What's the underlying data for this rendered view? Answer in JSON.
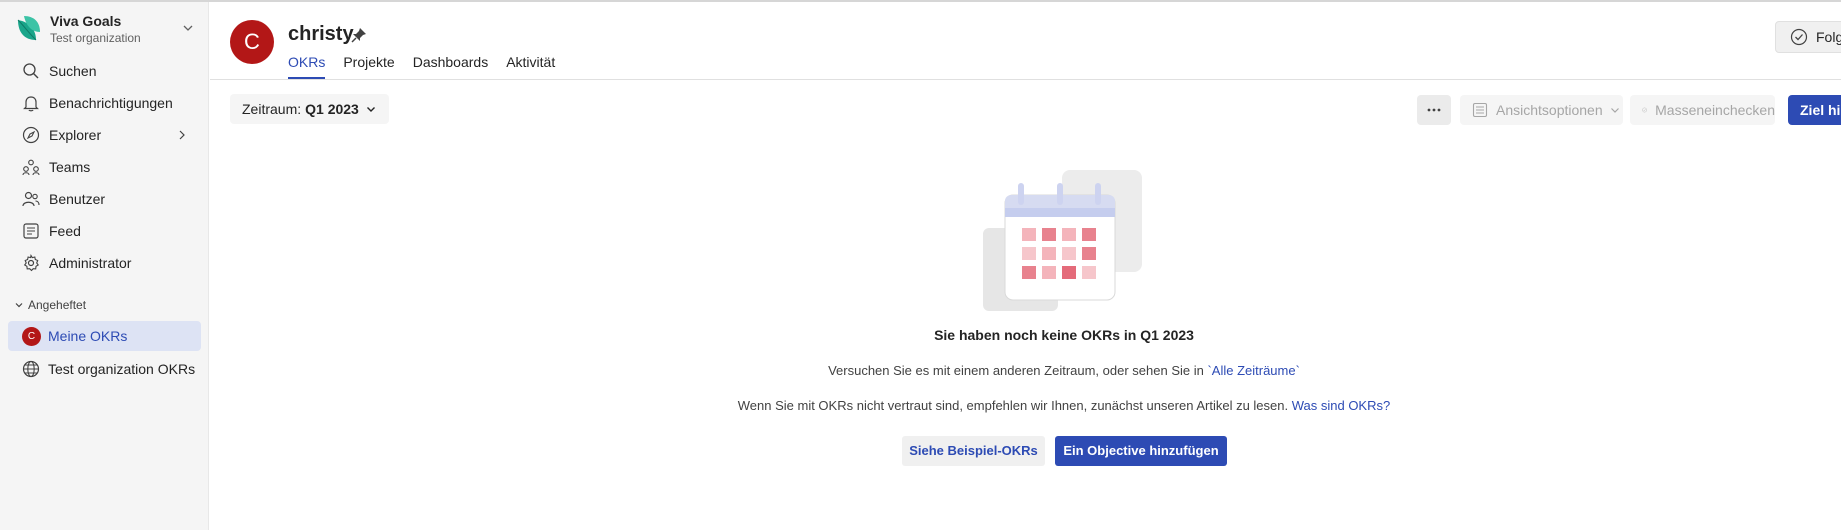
{
  "org": {
    "name": "Viva Goals",
    "subtitle": "Test organization"
  },
  "sidebar": {
    "items": [
      {
        "label": "Suchen",
        "icon": "search-icon"
      },
      {
        "label": "Benachrichtigungen",
        "icon": "bell-icon"
      },
      {
        "label": "Explorer",
        "icon": "compass-icon"
      },
      {
        "label": "Teams",
        "icon": "teams-icon"
      },
      {
        "label": "Benutzer",
        "icon": "users-icon"
      },
      {
        "label": "Feed",
        "icon": "feed-icon"
      },
      {
        "label": "Administrator",
        "icon": "gear-icon"
      }
    ],
    "pinned_section": "Angeheftet",
    "pinned": [
      {
        "label": "Meine OKRs",
        "avatar": "C"
      },
      {
        "label": "Test organization OKRs",
        "icon": "globe-icon"
      }
    ]
  },
  "header": {
    "avatar": "C",
    "title": "christy",
    "tabs": [
      "OKRs",
      "Projekte",
      "Dashboards",
      "Aktivität"
    ],
    "follow_label": "Folgen"
  },
  "toolbar": {
    "period_label": "Zeitraum:",
    "period_value": "Q1 2023",
    "view_options": "Ansichtsoptionen",
    "bulk_checkin": "Masseneinchecken",
    "add_goal": "Ziel hinzufügen"
  },
  "empty": {
    "title": "Sie haben noch keine OKRs in Q1 2023",
    "line1_prefix": "Versuchen Sie es mit einem anderen Zeitraum, oder sehen Sie in ",
    "line1_link": "`Alle Zeiträume`",
    "line2_prefix": "Wenn Sie mit OKRs nicht vertraut sind, empfehlen wir Ihnen, zunächst unseren Artikel zu lesen. ",
    "line2_link": "Was sind OKRs?",
    "btn_examples": "Siehe Beispiel-OKRs",
    "btn_add": "Ein Objective hinzufügen"
  },
  "colors": {
    "accent": "#2d4bb4",
    "avatar": "#b31717",
    "active_bg": "#dde3f4"
  }
}
